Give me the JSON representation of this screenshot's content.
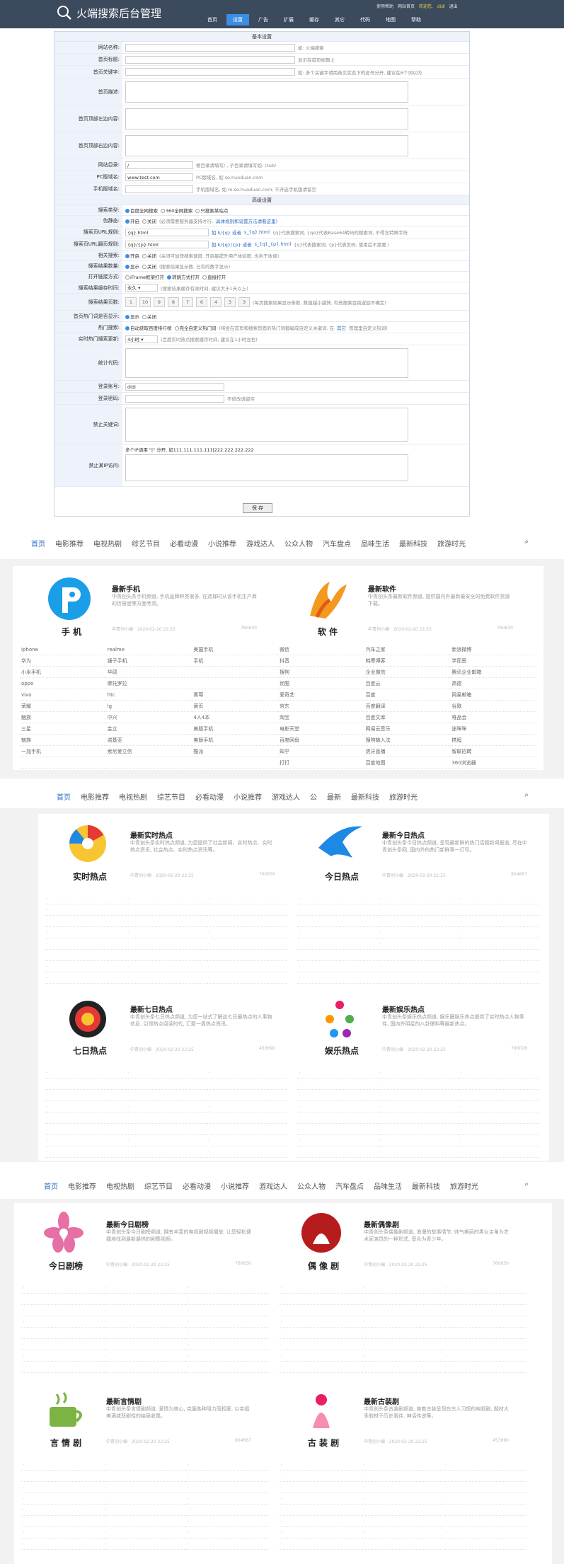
{
  "admin": {
    "title": "火端搜索后台管理",
    "nav": [
      "首页",
      "设置",
      "广告",
      "扩展",
      "缓存",
      "其它",
      "代码",
      "地图",
      "帮助"
    ],
    "nav_active": 1,
    "user": [
      "使用帮助",
      "网站首页",
      "欢迎您,",
      "didi",
      "退出"
    ]
  },
  "form": {
    "basic_title": "基本设置",
    "advanced_title": "高级设置",
    "rows": {
      "site_name": {
        "label": "网站名称:",
        "hint": "如: 火端搜索"
      },
      "home_title": {
        "label": "首页标题:",
        "hint": "显示在首页标题上"
      },
      "home_keywords": {
        "label": "首页关键字:",
        "hint": "如: 多个关键字请用英文状态下的逗号分开, 建议在6个词以内"
      },
      "home_desc": {
        "label": "首页描述:"
      },
      "top_content": {
        "label": "首页顶部左边内容:"
      },
      "top_content2": {
        "label": "首页顶部右边内容:"
      },
      "site_dir": {
        "label": "网站目录:",
        "value": "/",
        "hint": "根目录请填写/ , 子目录请填写如: /sub/"
      },
      "pc_domain": {
        "label": "PC版域名:",
        "value": "www.test.com",
        "hint": "PC版域名, 如 so.huoduan.com"
      },
      "mobile_domain": {
        "label": "手机版域名:",
        "hint": "手机版域名, 如 m.so.huoduan.com, 不开启手机版请留空"
      },
      "search_type": {
        "label": "搜索类型:",
        "opts": [
          "百度全网搜索",
          "360全网搜索",
          "只搜索某站点"
        ]
      },
      "pseudo": {
        "label": "伪静态:",
        "opts": [
          "开启",
          "关闭"
        ],
        "hint": "(必须需要服务器支持才行,",
        "link": "具体规则和设置方法请看这里)"
      },
      "search_url": {
        "label": "搜索页URL规则:",
        "value": "{q}.html",
        "mid": "如 k/{q} 或者",
        "link": "s_{q}.html",
        "hint": "{q}代表搜索词, {qe}代表Base64转码的搜索词, 不得含特殊字符"
      },
      "search_page_url": {
        "label": "搜索页URL翻页规则:",
        "value": "{q}/{p}.html",
        "mid": "如 k/{q}/{p} 或者",
        "link": "s_{q}_{p}.html",
        "hint": "{q}代表搜索词, {p}代表页码, 使用后不需要 /"
      },
      "related": {
        "label": "相关搜索:",
        "opts": [
          "开启",
          "关闭"
        ],
        "hint": "(关闭可加快搜索速度, 开启能提升用户体验度, 也利于收录)"
      },
      "show_num": {
        "label": "搜索结果数量:",
        "opts": [
          "显示",
          "关闭"
        ],
        "hint": "(搜索结果显示数, 已有的数字显示)"
      },
      "open_mode": {
        "label": "打开链接方式:",
        "opts": [
          "iFrame框架打开",
          "转跳方式打开",
          "直接打开"
        ]
      },
      "cache_time": {
        "label": "搜索结果缓存时间:",
        "value": "永久",
        "hint": "(搜索结果缓存有效时间, 建议大于1天以上)"
      },
      "pages": {
        "label": "搜索结果页数:",
        "nums": [
          "1",
          "10",
          "9",
          "8",
          "7",
          "6",
          "4",
          "3",
          "3"
        ],
        "hint": "(每页搜索结果显示条数, 数值越小越快, 有些搜索目前返回不确定)"
      },
      "hot_show": {
        "label": "首页热门词是否显示:",
        "opts": [
          "显示",
          "关闭"
        ]
      },
      "hot_update": {
        "label": "热门搜索:",
        "opts": [
          "自动获取百度排行榜",
          "完全自定义热门词"
        ],
        "hint": "(将会在首页和搜索页面的热门词都编成自定义关键词, 在",
        "link": "其它",
        "hint2": "管理里自定义热词)"
      },
      "hot_cache": {
        "label": "实时热门搜索更新:",
        "value": "4小时",
        "hint": "(百度实时热点搜索缓存时间, 建议在1小时左右)"
      },
      "stat_code": {
        "label": "统计代码:"
      },
      "login_user": {
        "label": "登录账号:",
        "value": "didi"
      },
      "login_pass": {
        "label": "登录密码:",
        "hint": "不修改请留空"
      },
      "ban_words": {
        "label": "禁止关键词:",
        "hint": "多个IP请用 \"|\" 分开, 如111.111.111.111|222.222.222.222"
      },
      "ban_ip": {
        "label": "禁止某IP访问:"
      }
    },
    "save": "保 存"
  },
  "front": {
    "nav": [
      "首页",
      "电影推荐",
      "电视热剧",
      "综艺节目",
      "必看动漫",
      "小说推荐",
      "游戏达人",
      "公众人物",
      "汽车盘点",
      "品味生活",
      "最新科技",
      "旅游时光"
    ],
    "nav2": [
      "首页",
      "电影推荐",
      "电视热剧",
      "综艺节目",
      "必看动漫",
      "小说推荐",
      "游戏达人",
      "公",
      "最新",
      "最新科技",
      "旅游时光"
    ],
    "meta_user": "中青创小编",
    "meta_date": "2020-02-20 22:25",
    "sec1": [
      {
        "title": "最新手机",
        "caption": "手 机",
        "desc": "中青创头条手机频道, 手机品牌种类很多, 在选择时从该手机生产商的信誉度等方面考虑。",
        "views": "760630",
        "links": [
          [
            "iphone",
            "realme",
            "美国手机",
            "微信",
            "汽车之家",
            "新浪微博"
          ],
          [
            "华为",
            "锤子手机",
            "手机",
            "抖音",
            "韩寒博客",
            "学而思"
          ],
          [
            "小米手机",
            "华硕",
            "",
            "搜狗",
            "企业微信",
            "腾讯企业邮箱"
          ],
          [
            "oppo",
            "摩托罗拉",
            "",
            "优酷",
            "百度云",
            "高德"
          ],
          [
            "vivo",
            "htc",
            "黑莓",
            "爱奇艺",
            "百度",
            "网易邮箱"
          ],
          [
            "荣耀",
            "lg",
            "黄页",
            "京东",
            "百度翻译",
            "谷歌"
          ],
          [
            "魅族",
            "中兴",
            "4人4本",
            "淘宝",
            "百度文库",
            "唯品会"
          ],
          [
            "三星",
            "金立",
            "美版手机",
            "电影天堂",
            "网易云音乐",
            "途咪咪"
          ],
          [
            "魅族",
            "诺基亚",
            "美版手机",
            "百度网盘",
            "搜狗输入法",
            "携程"
          ],
          [
            "一加手机",
            "索尼爱立信",
            "酷派",
            "知乎",
            "虎牙直播",
            "智联招聘"
          ],
          [
            "",
            "",
            "",
            "打打",
            "百度地图",
            "360浏览器"
          ]
        ]
      },
      {
        "title": "最新软件",
        "caption": "软 件",
        "desc": "中青创头条最新软件频道, 提供国内外最新最安全的免费软件资源下载。",
        "views": "760630"
      }
    ],
    "sec2": [
      {
        "title": "最新实时热点",
        "caption": "实时热点",
        "desc": "中青创头条实时热点频道, 为您提供了社会新闻、实时热点、实时热点资讯, 社会热点、实时热点资讯等。",
        "views": "760630"
      },
      {
        "title": "最新今日热点",
        "caption": "今日热点",
        "desc": "中青创头条今日热点频道, 呈现最新鲜的热门话题新闻报道, 尽在中青创头条网, 国内外的热门新鲜事一打尽。",
        "views": "804667"
      },
      {
        "title": "最新七日热点",
        "caption": "七日热点",
        "desc": "中青创头条七日热点频道, 为您一站式了解这七日最热点的人事物信息, 引领热点阅读时代, 汇聚一周热点资讯。",
        "views": "453690"
      },
      {
        "title": "最新娱乐热点",
        "caption": "娱乐热点",
        "desc": "中青创头条娱乐热点频道, 娱乐圈娱乐热点提供了实时热点人物事件, 国内外明星的八卦爆料等最新热点。",
        "views": "790028"
      }
    ],
    "sec3": [
      {
        "title": "最新今日剧榜",
        "caption": "今日剧榜",
        "desc": "中青创头条今日剧榜频道, 拥有丰富的电视剧视频播放, 让您轻松便捷地找到最新最热的剧集视频。",
        "views": "760630"
      },
      {
        "title": "最新偶像剧",
        "caption": "偶 像 剧",
        "desc": "中青创头条偶像剧频道, 浪漫的故事情节, 帅气美丽的男女主角为艺术家演员的一种形式, 受众为青少年。",
        "views": "760630"
      },
      {
        "title": "最新言情剧",
        "caption": "言 情 剧",
        "desc": "中青创头条言情剧频道, 爱情为核心, 克服各种阻力而相爱, 以幸福美满或悲剧性的结局收尾。",
        "views": "804667"
      },
      {
        "title": "最新古装剧",
        "caption": "古 装 剧",
        "desc": "中青创头条古装剧频道, 穿着古装呈现在古人习惯的电视剧, 题材大多取材于历史事件, 神话传说等。",
        "views": "453690"
      }
    ]
  }
}
